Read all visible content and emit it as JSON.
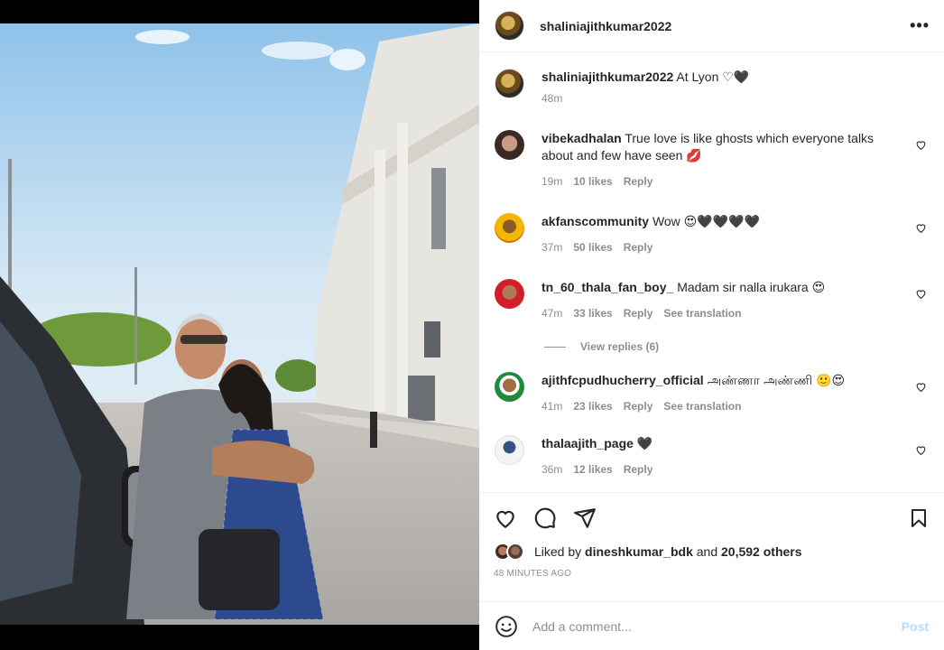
{
  "post": {
    "username": "shaliniajithkumar2022",
    "more_icon": "more-horizontal-icon",
    "caption": {
      "user": "shaliniajithkumar2022",
      "text": "At Lyon ♡🖤",
      "time": "48m"
    }
  },
  "comments": [
    {
      "user": "vibekadhalan",
      "text": "True love is like ghosts which everyone talks about and few have seen 💋",
      "time": "19m",
      "likes": "10 likes",
      "reply": "Reply",
      "translation": ""
    },
    {
      "user": "akfanscommunity",
      "text": "Wow 😍🖤🖤🖤🖤",
      "time": "37m",
      "likes": "50 likes",
      "reply": "Reply",
      "translation": ""
    },
    {
      "user": "tn_60_thala_fan_boy_",
      "text": "Madam sir nalla irukara 😍",
      "time": "47m",
      "likes": "33 likes",
      "reply": "Reply",
      "translation": "See translation"
    },
    {
      "user": "ajithfcpudhucherry_official",
      "text": "அண்ணா அண்ணி 🙂😍",
      "time": "41m",
      "likes": "23 likes",
      "reply": "Reply",
      "translation": "See translation"
    },
    {
      "user": "thalaajith_page",
      "text": "🖤",
      "time": "36m",
      "likes": "12 likes",
      "reply": "Reply",
      "translation": ""
    }
  ],
  "view_replies": "View replies (6)",
  "likes": {
    "prefix": "Liked by",
    "user": "dineshkumar_bdk",
    "and": "and",
    "others": "20,592 others"
  },
  "posted_ago": "48 MINUTES AGO",
  "add_comment": {
    "placeholder": "Add a comment...",
    "post_label": "Post"
  },
  "colors": {
    "accent": "#0095f6",
    "post_disabled": "#b2dffc",
    "muted": "#8e8e8e"
  }
}
